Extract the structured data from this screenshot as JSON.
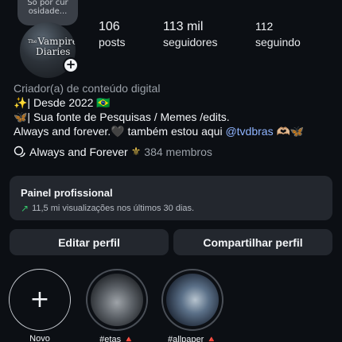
{
  "note": {
    "text": "Só por cur\nosidade..."
  },
  "avatar": {
    "title_small": "The",
    "title_line1": "Vampire",
    "title_line2": "Diaries",
    "badge": "+"
  },
  "stats": {
    "posts": {
      "value": "106",
      "label": "posts"
    },
    "followers": {
      "value": "113 mil",
      "label": "seguidores"
    },
    "following": {
      "value": "112",
      "label": "seguindo"
    }
  },
  "bio": {
    "category": "Criador(a) de conteúdo digital",
    "line1": "✨| Desde 2022 🇧🇷",
    "line2": "🦋| Sua fonte de Pesquisas / Memes /edits.",
    "line3_text": "Always and forever.🖤 também estou aqui ",
    "line3_mention": "@tvdbras",
    "line3_suffix": " 🫶🏼🦋"
  },
  "community": {
    "name": "Always and Forever",
    "symbol": "⚜",
    "members": "384 membros"
  },
  "pro_panel": {
    "title": "Painel profissional",
    "subtitle": "11,5 mi visualizações nos últimos 30 dias.",
    "trend_glyph": "↗"
  },
  "buttons": {
    "edit": "Editar perfil",
    "share": "Compartilhar perfil"
  },
  "highlights": [
    {
      "label": "Novo",
      "glyph": "+"
    },
    {
      "label": "#etas 🔺"
    },
    {
      "label": "#allpaper 🔺"
    }
  ],
  "colors": {
    "background": "#0c0f14",
    "panel": "#23272e",
    "mention": "#8fb4ff",
    "trend": "#35c46a"
  },
  "icons": {
    "community": "chat-bubbles-icon",
    "trend": "trending-up-icon",
    "add": "plus-icon"
  }
}
